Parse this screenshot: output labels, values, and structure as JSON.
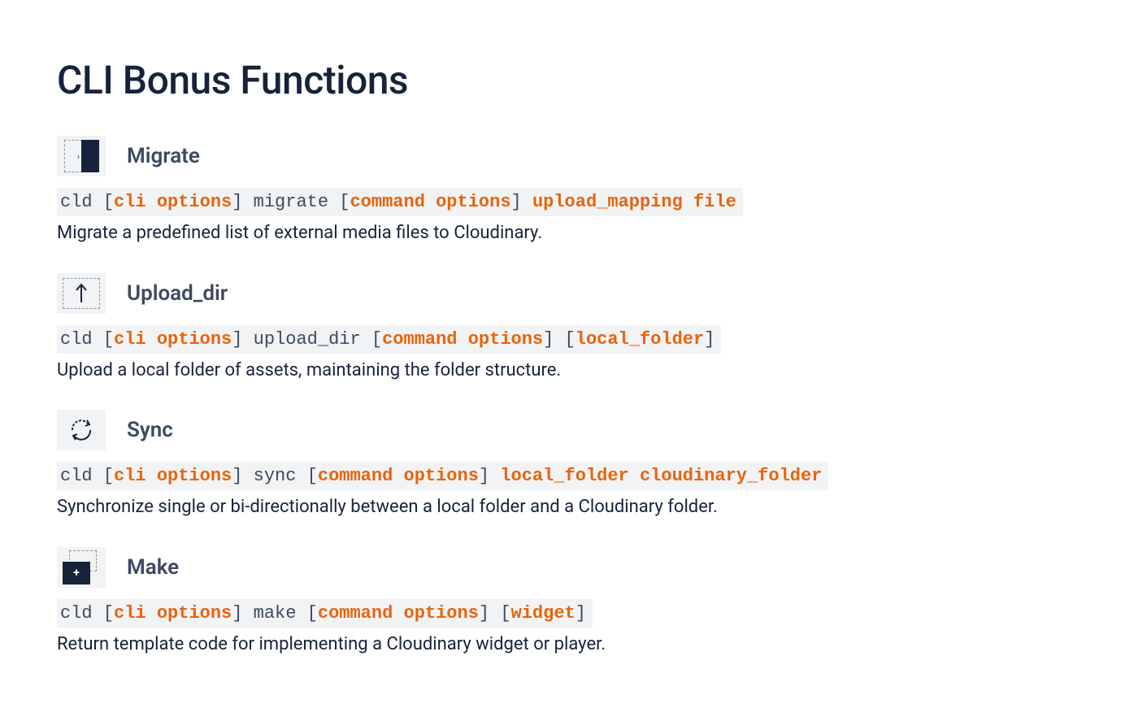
{
  "title": "CLI Bonus Functions",
  "functions": [
    {
      "name": "Migrate",
      "code": {
        "p0": "cld [",
        "h0": "cli options",
        "p1": "] migrate [",
        "h1": "command options",
        "p2": "] ",
        "h2": "upload_mapping file",
        "p3": ""
      },
      "desc": "Migrate a predefined list of external media files to Cloudinary."
    },
    {
      "name": "Upload_dir",
      "code": {
        "p0": "cld [",
        "h0": "cli options",
        "p1": "] upload_dir [",
        "h1": "command options",
        "p2": "] [",
        "h2": "local_folder",
        "p3": "]"
      },
      "desc": "Upload a local folder of assets, maintaining the folder structure."
    },
    {
      "name": "Sync",
      "code": {
        "p0": "cld [",
        "h0": "cli options",
        "p1": "] sync [",
        "h1": "command options",
        "p2": "] ",
        "h2": "local_folder cloudinary_folder",
        "p3": ""
      },
      "desc": "Synchronize single or bi-directionally between a local folder and a Cloudinary folder."
    },
    {
      "name": "Make",
      "code": {
        "p0": "cld [",
        "h0": "cli options",
        "p1": "] make [",
        "h1": "command options",
        "p2": "] [",
        "h2": "widget",
        "p3": "]"
      },
      "desc": "Return template code for implementing a Cloudinary widget or player."
    }
  ]
}
